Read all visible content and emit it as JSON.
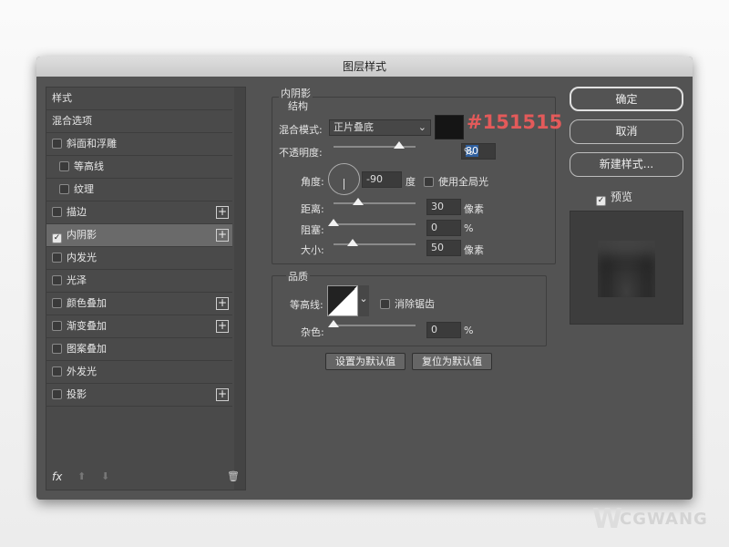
{
  "dialog": {
    "title": "图层样式"
  },
  "sidebar": {
    "items": [
      {
        "label": "样式",
        "checkbox": false,
        "plus": false
      },
      {
        "label": "混合选项",
        "checkbox": false,
        "plus": false
      },
      {
        "label": "斜面和浮雕",
        "checkbox": true,
        "checked": false,
        "plus": false
      },
      {
        "label": "等高线",
        "checkbox": true,
        "checked": false,
        "plus": false,
        "indent": true
      },
      {
        "label": "纹理",
        "checkbox": true,
        "checked": false,
        "plus": false,
        "indent": true
      },
      {
        "label": "描边",
        "checkbox": true,
        "checked": false,
        "plus": true
      },
      {
        "label": "内阴影",
        "checkbox": true,
        "checked": true,
        "plus": true,
        "selected": true
      },
      {
        "label": "内发光",
        "checkbox": true,
        "checked": false,
        "plus": false
      },
      {
        "label": "光泽",
        "checkbox": true,
        "checked": false,
        "plus": false
      },
      {
        "label": "颜色叠加",
        "checkbox": true,
        "checked": false,
        "plus": true
      },
      {
        "label": "渐变叠加",
        "checkbox": true,
        "checked": false,
        "plus": true
      },
      {
        "label": "图案叠加",
        "checkbox": true,
        "checked": false,
        "plus": false
      },
      {
        "label": "外发光",
        "checkbox": true,
        "checked": false,
        "plus": false
      },
      {
        "label": "投影",
        "checkbox": true,
        "checked": false,
        "plus": true
      }
    ],
    "fx_label": "fx"
  },
  "inner_shadow": {
    "title": "内阴影",
    "section": "结构",
    "blend_mode_label": "混合模式:",
    "blend_mode": "正片叠底",
    "color": "#151515",
    "color_annotation": "#151515",
    "opacity_label": "不透明度:",
    "opacity": "80",
    "opacity_unit": "%",
    "angle_label": "角度:",
    "angle": "-90",
    "angle_unit": "度",
    "global_light_label": "使用全局光",
    "global_light": false,
    "distance_label": "距离:",
    "distance": "30",
    "distance_unit": "像素",
    "choke_label": "阻塞:",
    "choke": "0",
    "choke_unit": "%",
    "size_label": "大小:",
    "size": "50",
    "size_unit": "像素"
  },
  "quality": {
    "title": "品质",
    "contour_label": "等高线:",
    "antialias_label": "消除锯齿",
    "antialias": false,
    "noise_label": "杂色:",
    "noise": "0",
    "noise_unit": "%"
  },
  "buttons": {
    "set_default": "设置为默认值",
    "reset_default": "复位为默认值",
    "ok": "确定",
    "cancel": "取消",
    "new_style": "新建样式...",
    "preview_label": "预览",
    "preview": true
  },
  "watermark": {
    "text": "CGWANG"
  }
}
